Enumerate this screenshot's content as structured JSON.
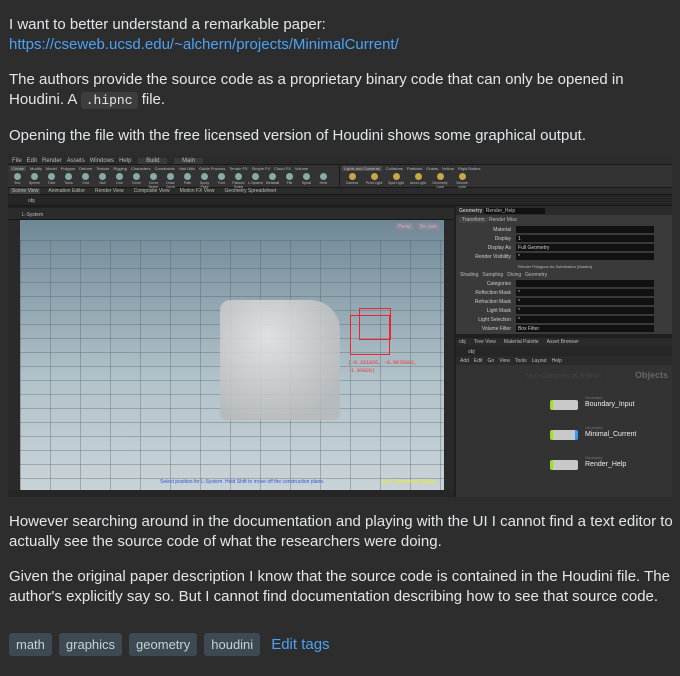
{
  "post": {
    "p1_text": "I want to better understand a remarkable paper: ",
    "p1_link": "https://cseweb.ucsd.edu/~alchern/projects/MinimalCurrent/",
    "p2_text_a": "The authors provide the source code as a proprietary binary code that can only be opened in Houdini. A ",
    "p2_code": ".hipnc",
    "p2_text_b": " file.",
    "p3": "Opening the file with the free licensed version of Houdini shows some graphical output.",
    "p4": "However searching around in the documentation and playing with the UI I cannot find a text editor to actually see the source code of what the researchers were doing.",
    "p5": "Given the original paper description I know that the source code is contained in the Houdini file. The author's explicitly say so. But I cannot find documentation describing how to see that source code."
  },
  "screenshot": {
    "menu": [
      "File",
      "Edit",
      "Render",
      "Assets",
      "Windows",
      "Help"
    ],
    "desktop": "Build",
    "main": "Main",
    "shelf_tabs": [
      "Create",
      "Modify",
      "Model",
      "Polygon",
      "Deform",
      "Texture",
      "Rigging",
      "Characters",
      "Constraints",
      "Hair Utils",
      "Guide Process",
      "Terrain FX",
      "Simple FX",
      "Cloud FX",
      "Volume"
    ],
    "shelf_tools": [
      "Box",
      "Sphere",
      "Tube",
      "Torus",
      "Grid",
      "Null",
      "Line",
      "Circle",
      "Curve Bezier",
      "Draw Curve",
      "Path",
      "Spray Paint",
      "Font",
      "Platonic Solids",
      "L-System",
      "Metaball",
      "File",
      "Spiral",
      "Helix"
    ],
    "light_tabs": [
      "Lights and Cameras",
      "Collisions",
      "Particles",
      "Grains",
      "Vellum",
      "Rigid Bodies"
    ],
    "light_tools": [
      "Camera",
      "Point Light",
      "Spot Light",
      "Area Light",
      "Geometry Light",
      "Volume Light"
    ],
    "pane_tabs": [
      "Scene View",
      "Animation Editor",
      "Render View",
      "Composite View",
      "Motion FX View",
      "Geometry Spreadsheet"
    ],
    "path": "obj",
    "tool_name": "L-System",
    "persp": "Persp",
    "cam": "No cam",
    "coords": "(-0.161826, -0.0076002, -1.99920)",
    "hint": "Select position for L-System. Hold Shift to move off the construction plane.",
    "nce": "Non-Commercial Edition",
    "params": {
      "type": "Geometry",
      "name": "Render_Help",
      "tabs": [
        "Transform",
        "Render",
        "Misc"
      ],
      "rows": [
        {
          "label": "Material",
          "value": ""
        },
        {
          "label": "Display",
          "value": "1"
        },
        {
          "label": "Display As",
          "value": "Full Geometry"
        },
        {
          "label": "Render Visibility",
          "value": "*"
        }
      ],
      "checkbox": "Render Polygons As Subdivision (Mantra)",
      "subtabs": [
        "Shading",
        "Sampling",
        "Dicing",
        "Geometry"
      ],
      "rows2": [
        {
          "label": "Categories",
          "value": ""
        },
        {
          "label": "Reflection Mask",
          "value": "*"
        },
        {
          "label": "Refraction Mask",
          "value": "*"
        },
        {
          "label": "Light Mask",
          "value": "*"
        },
        {
          "label": "Light Selection",
          "value": "*"
        },
        {
          "label": "Volume Filter",
          "value": "Box Filter"
        }
      ]
    },
    "network": {
      "tabs": [
        "obj",
        "Tree View",
        "Material Palette",
        "Asset Browser"
      ],
      "menu": [
        "Add",
        "Edit",
        "Go",
        "View",
        "Tools",
        "Layout",
        "Help"
      ],
      "watermark": "Non-Commercial Edition",
      "context": "Objects",
      "nodes": [
        {
          "type": "Geometry",
          "name": "Boundary_Input"
        },
        {
          "type": "Geometry",
          "name": "Minimal_Current"
        },
        {
          "type": "Geometry",
          "name": "Render_Help"
        }
      ]
    }
  },
  "tags": [
    "math",
    "graphics",
    "geometry",
    "houdini"
  ],
  "edit_tags": "Edit tags",
  "colors": {
    "background": "#2d2d2d",
    "link": "#4ca3f5",
    "tag_bg": "#3d4a52"
  }
}
